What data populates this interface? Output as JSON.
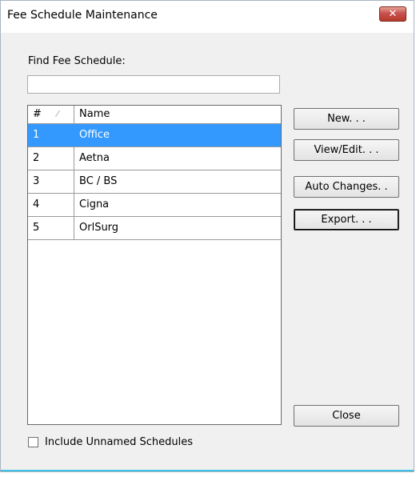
{
  "window": {
    "title": "Fee Schedule Maintenance",
    "close_glyph": "✕"
  },
  "find": {
    "label": "Find Fee Schedule:",
    "value": "",
    "placeholder": ""
  },
  "grid": {
    "columns": [
      "#",
      "Name"
    ],
    "sort_indicator": "⁄",
    "rows": [
      {
        "num": "1",
        "name": "Office",
        "selected": true
      },
      {
        "num": "2",
        "name": "Aetna"
      },
      {
        "num": "3",
        "name": "BC / BS"
      },
      {
        "num": "4",
        "name": "Cigna"
      },
      {
        "num": "5",
        "name": "OrlSurg"
      }
    ]
  },
  "buttons": {
    "new": "New. . .",
    "view_edit": "View/Edit. . .",
    "auto_changes": "Auto Changes. .",
    "export": "Export. . .",
    "close": "Close"
  },
  "options": {
    "include_unnamed_label": "Include Unnamed Schedules",
    "include_unnamed_checked": false
  },
  "colors": {
    "selection": "#3399ff",
    "close_button": "#c75050"
  }
}
